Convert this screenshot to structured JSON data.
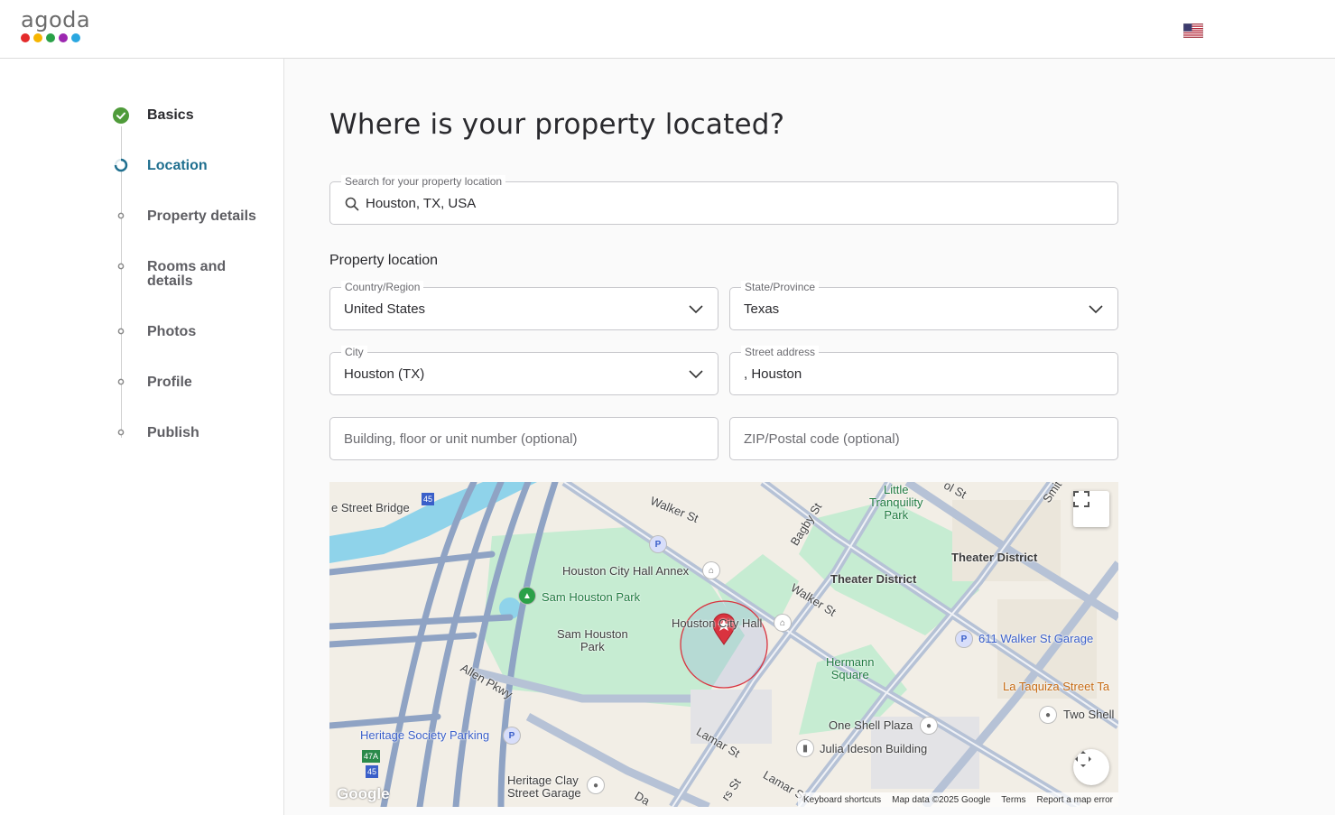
{
  "brand": {
    "logo_text": "agoda",
    "dot_colors": [
      "#e42b2b",
      "#f6b500",
      "#2aa148",
      "#9c27b0",
      "#2aa7e0"
    ]
  },
  "steps": [
    {
      "label": "Basics",
      "state": "done"
    },
    {
      "label": "Location",
      "state": "active"
    },
    {
      "label": "Property details",
      "state": "pending"
    },
    {
      "label": "Rooms and details",
      "state": "pending"
    },
    {
      "label": "Photos",
      "state": "pending"
    },
    {
      "label": "Profile",
      "state": "pending"
    },
    {
      "label": "Publish",
      "state": "pending"
    }
  ],
  "page": {
    "title": "Where is your property located?",
    "search": {
      "legend": "Search for your property location",
      "value": "Houston, TX, USA"
    },
    "section_label": "Property location",
    "country": {
      "legend": "Country/Region",
      "value": "United States"
    },
    "state": {
      "legend": "State/Province",
      "value": "Texas"
    },
    "city": {
      "legend": "City",
      "value": "Houston (TX)"
    },
    "street": {
      "legend": "Street address",
      "value": ", Houston"
    },
    "building": {
      "placeholder": "Building, floor or unit number (optional)"
    },
    "zip": {
      "placeholder": "ZIP/Postal code (optional)"
    }
  },
  "map": {
    "labels": {
      "street_bridge": "e Street Bridge",
      "walker_st": "Walker St",
      "walker_st2": "Walker St",
      "bagby_st": "Bagby St",
      "little_tranquility": "Little\nTranquility\nPark",
      "theater_district": "Theater District",
      "theater_district2": "Theater District",
      "annex": "Houston City Hall Annex",
      "sam_houston_park": "Sam Houston Park",
      "sam_houston_park2": "Sam Houston\nPark",
      "city_hall": "Houston City Hall",
      "garage": "611 Walker St Garage",
      "hermann_square": "Hermann\nSquare",
      "taquiza": "La Taquiza Street Ta",
      "allen_pkwy": "Allen Pkwy",
      "heritage_parking": "Heritage Society Parking",
      "one_shell": "One Shell Plaza",
      "two_shell": "Two Shell",
      "julia_ideson": "Julia Ideson Building",
      "lamar_st": "Lamar St",
      "lamar_st2": "Lamar St",
      "heritage_clay": "Heritage Clay\nStreet Garage",
      "ol_st": "ol St",
      "smith": "Smit",
      "i45": "45",
      "i45b": "45",
      "exit47a": "47A",
      "dal": "Da",
      "rs_st": "rs St"
    },
    "footer": [
      "Keyboard shortcuts",
      "Map data ©2025 Google",
      "Terms",
      "Report a map error"
    ],
    "google": "Google",
    "colors": {
      "park": "#c7ecd3",
      "road": "#a9b6cc",
      "highway": "#8fa3c4",
      "water": "#8fd3ea",
      "pin": "#d9333f"
    }
  }
}
